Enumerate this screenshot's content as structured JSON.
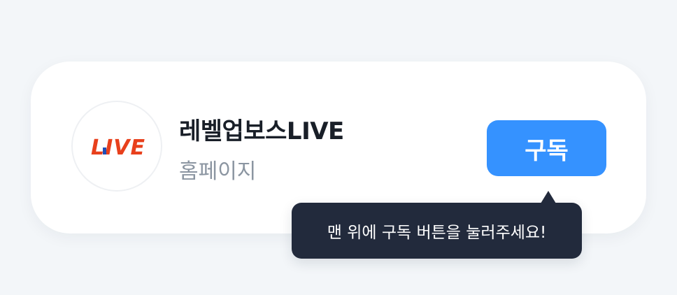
{
  "channel": {
    "logo_text": "LIVE",
    "name": "레벨업보스LIVE",
    "subtitle": "홈페이지"
  },
  "subscribe_button": {
    "label": "구독",
    "color": "#3592ff"
  },
  "tooltip": {
    "text": "맨 위에 구독 버튼을 눌러주세요!"
  },
  "colors": {
    "logo_red": "#e8401c",
    "logo_blue": "#1f4fb8",
    "tooltip_bg": "#222a3c",
    "page_bg": "#f3f6f9"
  }
}
